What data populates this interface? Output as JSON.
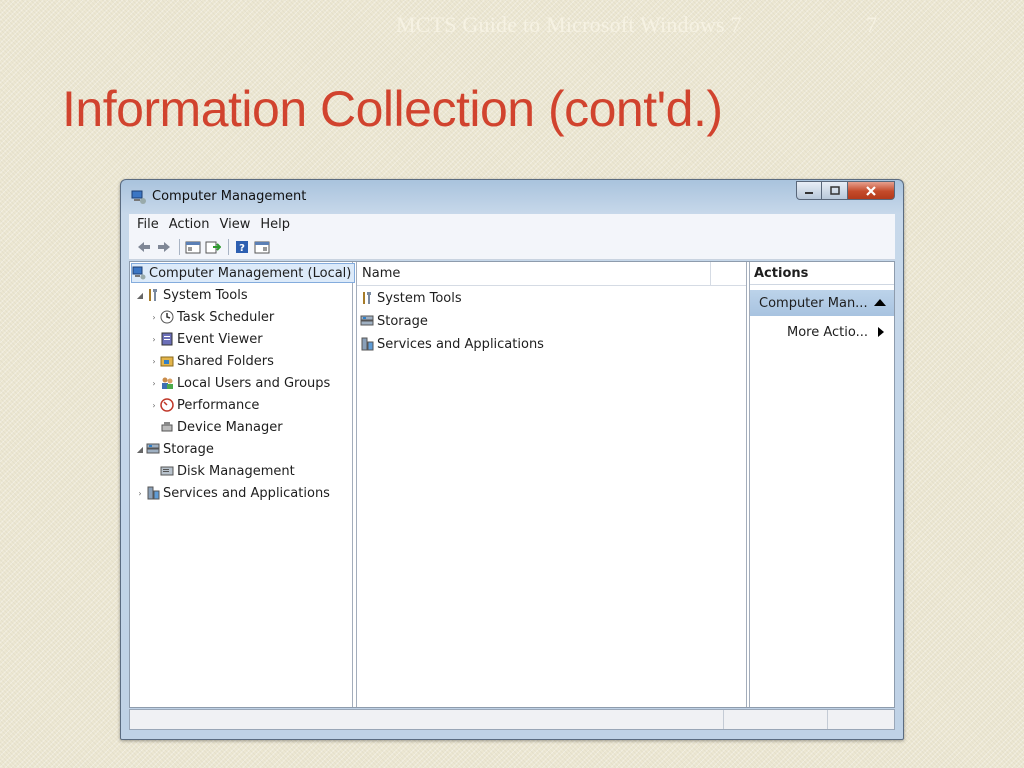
{
  "slide": {
    "header": "MCTS Guide to Microsoft Windows 7",
    "page_number": "7",
    "title": "Information Collection (cont'd.)"
  },
  "window": {
    "title": "Computer Management",
    "menu": [
      "File",
      "Action",
      "View",
      "Help"
    ]
  },
  "tree": [
    {
      "label": "Computer Management (Local)",
      "icon": "computer-management-icon",
      "expander": "",
      "selected": true
    },
    {
      "label": "System Tools",
      "icon": "system-tools-icon",
      "expander": "expanded"
    },
    {
      "label": "Task Scheduler",
      "icon": "task-scheduler-icon",
      "expander": "collapsed"
    },
    {
      "label": "Event Viewer",
      "icon": "event-viewer-icon",
      "expander": "collapsed"
    },
    {
      "label": "Shared Folders",
      "icon": "shared-folders-icon",
      "expander": "collapsed"
    },
    {
      "label": "Local Users and Groups",
      "icon": "local-users-icon",
      "expander": "collapsed"
    },
    {
      "label": "Performance",
      "icon": "performance-icon",
      "expander": "collapsed"
    },
    {
      "label": "Device Manager",
      "icon": "device-manager-icon",
      "expander": ""
    },
    {
      "label": "Storage",
      "icon": "storage-icon",
      "expander": "expanded"
    },
    {
      "label": "Disk Management",
      "icon": "disk-management-icon",
      "expander": ""
    },
    {
      "label": "Services and Applications",
      "icon": "services-applications-icon",
      "expander": "collapsed"
    }
  ],
  "list": {
    "column_header": "Name",
    "items": [
      {
        "label": "System Tools",
        "icon": "system-tools-icon"
      },
      {
        "label": "Storage",
        "icon": "storage-icon"
      },
      {
        "label": "Services and Applications",
        "icon": "services-applications-icon"
      }
    ]
  },
  "actions": {
    "header": "Actions",
    "section": "Computer Man...",
    "items": [
      "More Actio..."
    ]
  }
}
